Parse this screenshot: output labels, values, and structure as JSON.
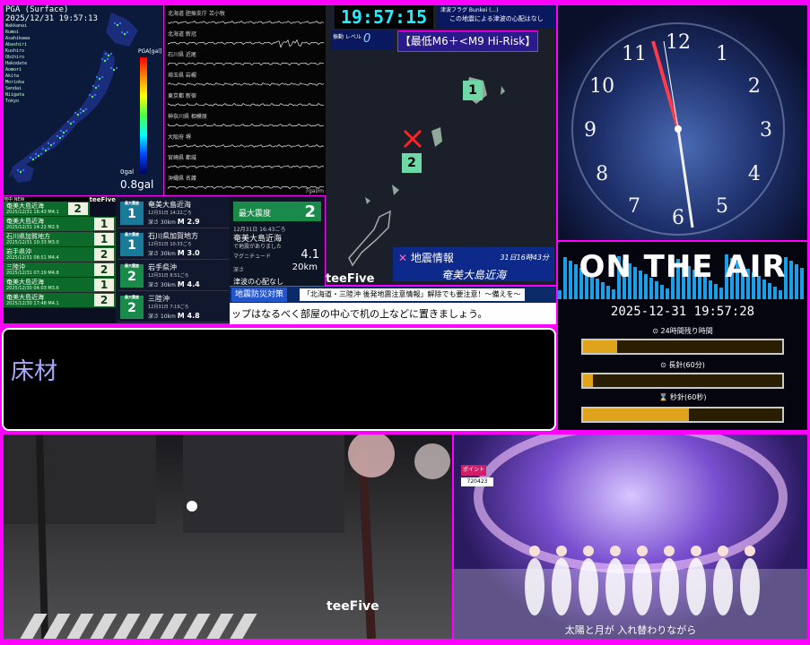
{
  "pga": {
    "header": "PGA (Surface)",
    "datetime": "2025/12/31 19:57:13",
    "station_list": [
      "Wakkanai",
      "Rumoi",
      "Asahikawa",
      "Abashiri",
      "Kushiro",
      "Obihiro",
      "Hakodate",
      "Aomori",
      "Akita",
      "Morioka",
      "Sendai",
      "Niigata",
      "Tokyo"
    ],
    "legend_title": "PGA[gal]",
    "gal_small": "0gal",
    "gal_value": "0.8gal"
  },
  "seismograph": {
    "traces": [
      "北海道 胆振支庁 苫小牧",
      "北海道 新冠",
      "石川県 近尾",
      "埼玉県 岩槻",
      "東京都 新宿",
      "神奈川県 相模原",
      "大阪府 堺",
      "宮崎県 都城",
      "沖縄県 名護"
    ],
    "unit": "7gal/m"
  },
  "quake_list": {
    "header": "地中 NEW",
    "logo": "teeFive",
    "rows": [
      {
        "name": "奄美大島近海",
        "date": "2025/12/31 16:43",
        "mag": "M4.1",
        "intensity": "2"
      },
      {
        "name": "奄美大島近海",
        "date": "2025/12/31 14:22",
        "mag": "M2.9",
        "intensity": "1"
      },
      {
        "name": "石川県加賀地方",
        "date": "2025/12/31 10:33",
        "mag": "M3.0",
        "intensity": "1"
      },
      {
        "name": "岩手県沖",
        "date": "2025/12/31 08:51",
        "mag": "M4.4",
        "intensity": "2"
      },
      {
        "name": "三陸沖",
        "date": "2025/12/31 07:19",
        "mag": "M4.8",
        "intensity": "2"
      },
      {
        "name": "奄美大島近海",
        "date": "2025/12/30 04:03",
        "mag": "M3.6",
        "intensity": "1"
      },
      {
        "name": "奄美大島近海",
        "date": "2025/12/30 17:48",
        "mag": "M4.1",
        "intensity": "2"
      }
    ]
  },
  "quake_cards": [
    {
      "intensity": "1",
      "name": "奄美大島近海",
      "date": "12月31日 14:22ごろ",
      "depth": "深さ 30km",
      "mag": "M 2.9"
    },
    {
      "intensity": "1",
      "name": "石川県加賀地方",
      "date": "12月31日 10:33ごろ",
      "depth": "深さ 30km",
      "mag": "M 3.0"
    },
    {
      "intensity": "2",
      "name": "岩手県沖",
      "date": "12月31日 8:51ごろ",
      "depth": "深さ 30km",
      "mag": "M 4.4"
    },
    {
      "intensity": "2",
      "name": "三陸沖",
      "date": "12月31日 7:19ごろ",
      "depth": "深さ 10km",
      "mag": "M 4.8"
    }
  ],
  "quake_card_label": "最大震度",
  "detail": {
    "max_label": "最大震度",
    "max_value": "2",
    "time": "12月31日 16:43ごろ",
    "name": "奄美大島近海",
    "sub": "で地震がありました",
    "mag_label": "マグニチュード",
    "mag": "4.1",
    "depth_label": "深さ",
    "depth": "20km",
    "tsunami": "津波の心配なし",
    "logo": "teeFive"
  },
  "ticker": {
    "tag": "地震防災対策",
    "headline": "「北海道・三陸沖 後発地震注意情報」解除でも要注意！～備えを～",
    "message": "ップはなるべく部屋の中心で机の上などに置きましょう。"
  },
  "tsunami_map": {
    "clock": "19:57:15",
    "notice_top": "津波フラグ Bunkei (...)",
    "notice": "この地震による津波の心配はなし",
    "level_label": "振動 レベル",
    "level_value": "0",
    "risk": "【最低M6＋<M9 Hi-Risk】",
    "badge1": "1",
    "badge2": "2",
    "info_title": "地震情報",
    "info_time": "31日16時43分",
    "info_place": "奄美大島近海",
    "logo": "teeFive"
  },
  "caption": {
    "text": "床材"
  },
  "clock_panel": {
    "numbers": [
      "12",
      "1",
      "2",
      "3",
      "4",
      "5",
      "6",
      "7",
      "8",
      "9",
      "10",
      "11"
    ]
  },
  "on_air": {
    "title": "ON THE AIR",
    "datetime": "2025-12-31 19:57:28",
    "bars": [
      {
        "label": "24時間残り時間",
        "fraction": 0.17
      },
      {
        "label": "長針(60分)",
        "fraction": 0.05
      },
      {
        "label": "秒針(60秒)",
        "fraction": 0.53
      }
    ]
  },
  "camera": {
    "logo": "teeFive"
  },
  "stage": {
    "points_label": "ポイント",
    "points_value": "720423",
    "subtitle": "太陽と月が 入れ替わりながら"
  },
  "colors": {
    "border": "#ff00ff",
    "clock_cyan": "#22eeff",
    "bar_fill": "#e0a41c",
    "caption_text": "#a9a8ff"
  }
}
